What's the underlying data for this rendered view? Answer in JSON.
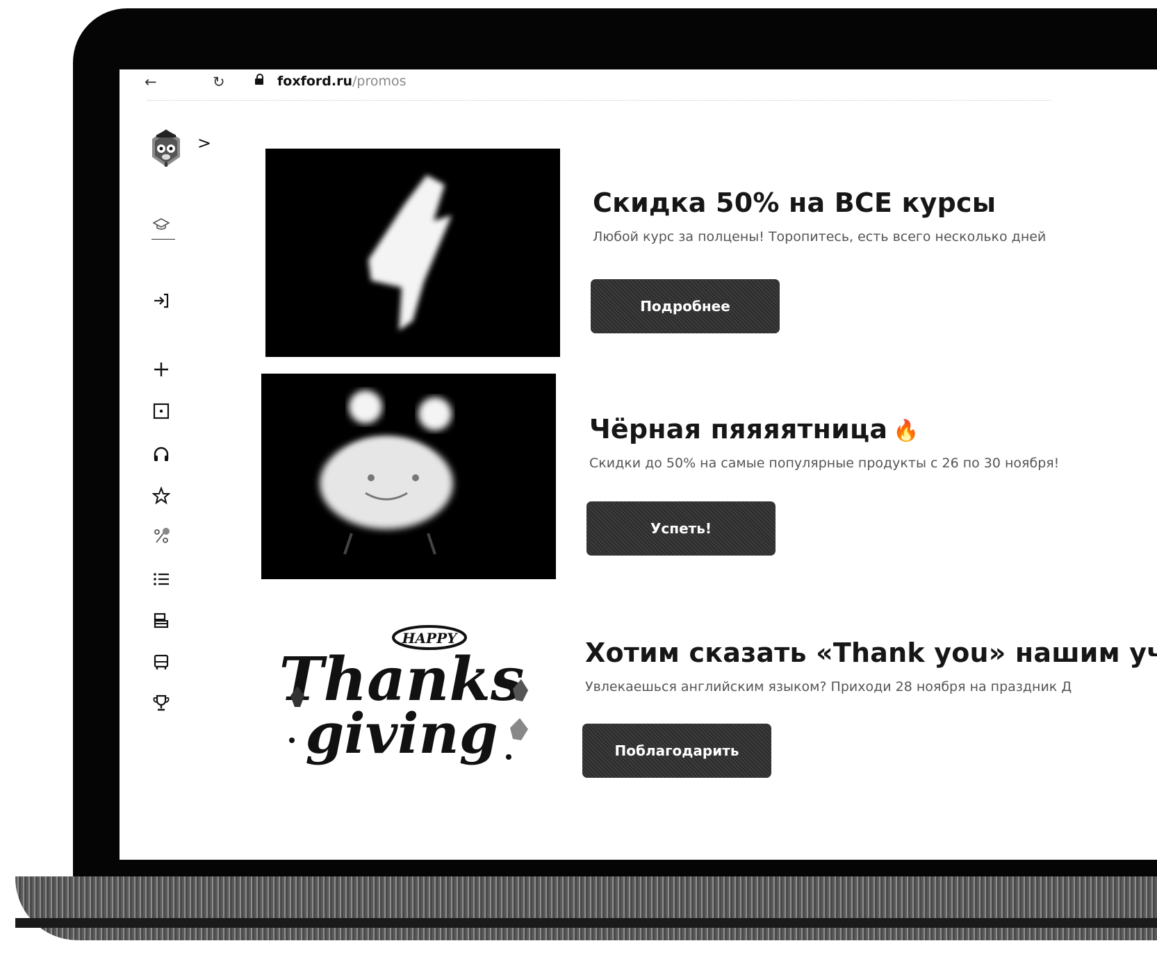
{
  "browser": {
    "url_domain": "foxford.ru",
    "url_path": "/promos"
  },
  "promos": [
    {
      "title": "Скидка 50% на ВСЕ курсы",
      "description": "Любой курс за полцены! Торопитесь, есть всего несколько дней",
      "button": "Подробнее"
    },
    {
      "title": "Чёрная пяяяятница",
      "description": "Скидки до 50% на самые популярные продукты с 26 по 30 ноября!",
      "button": "Успеть!"
    },
    {
      "title": "Хотим сказать «Thank you» нашим учен",
      "description": "Увлекаешься английским языком? Приходи 28 ноября на праздник Д",
      "button": "Поблагодарить",
      "image_text": "HAPPY Thanksgiving"
    }
  ],
  "sidebar_icons": [
    "graduation-cap-icon",
    "login-icon",
    "plus-icon",
    "square-dot-icon",
    "headphones-icon",
    "star-icon",
    "percent-icon",
    "list-icon",
    "layers-icon",
    "bus-icon",
    "trophy-icon"
  ]
}
